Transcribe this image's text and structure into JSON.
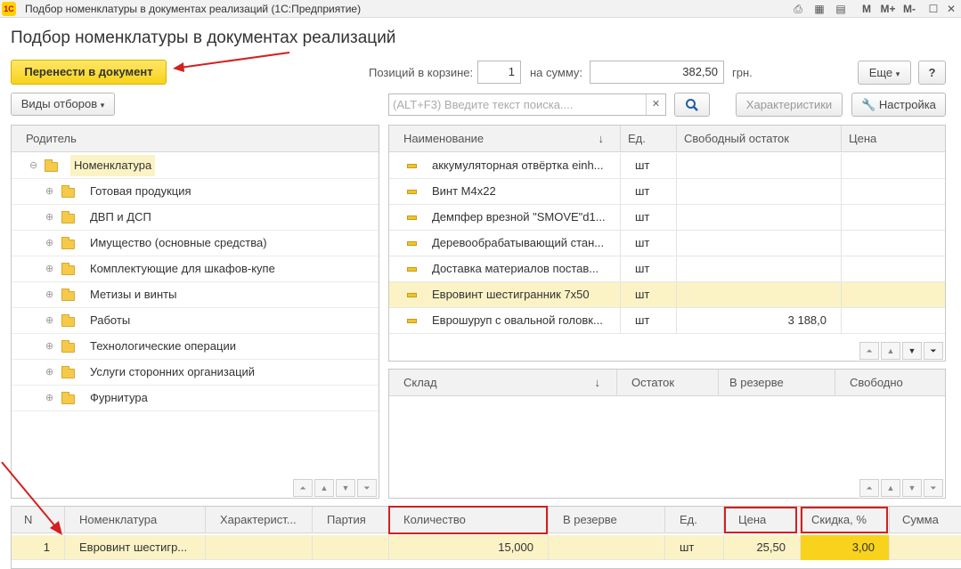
{
  "window": {
    "title": "Подбор номенклатуры в документах реализаций  (1С:Предприятие)",
    "logo": "1С",
    "controls": {
      "m": "M",
      "m_plus": "M+",
      "m_minus": "M-"
    }
  },
  "form": {
    "title": "Подбор номенклатуры в документах реализаций",
    "transfer_button": "Перенести в документ",
    "positions_label": "Позиций в корзине:",
    "positions_value": "1",
    "sum_label": "на сумму:",
    "sum_value": "382,50",
    "currency": "грн.",
    "more_button": "Еще",
    "help_button": "?",
    "filter_types_button": "Виды отборов",
    "search_placeholder": "(ALT+F3) Введите текст поиска....",
    "characteristics_button": "Характеристики",
    "settings_button": "Настройка"
  },
  "tree": {
    "header": "Родитель",
    "root": "Номенклатура",
    "items": [
      "Готовая продукция",
      "ДВП и ДСП",
      "Имущество (основные средства)",
      "Комплектующие для шкафов-купе",
      "Метизы и винты",
      "Работы",
      "Технологические операции",
      "Услуги сторонних организаций",
      "Фурнитура"
    ]
  },
  "products": {
    "columns": [
      "Наименование",
      "Ед.",
      "Свободный остаток",
      "Цена"
    ],
    "rows": [
      {
        "name": "аккумуляторная отвёртка einh...",
        "unit": "шт",
        "free": "",
        "price": ""
      },
      {
        "name": "Винт М4х22",
        "unit": "шт",
        "free": "",
        "price": ""
      },
      {
        "name": "Демпфер врезной \"SMOVE\"d1...",
        "unit": "шт",
        "free": "",
        "price": ""
      },
      {
        "name": "Деревообрабатывающий стан...",
        "unit": "шт",
        "free": "",
        "price": ""
      },
      {
        "name": "Доставка материалов постав...",
        "unit": "шт",
        "free": "",
        "price": ""
      },
      {
        "name": "Евровинт шестигранник 7х50",
        "unit": "шт",
        "free": "",
        "price": ""
      },
      {
        "name": "Еврошуруп с овальной головк...",
        "unit": "шт",
        "free": "3 188,0",
        "price": ""
      }
    ]
  },
  "warehouse": {
    "columns": [
      "Склад",
      "Остаток",
      "В резерве",
      "Свободно"
    ]
  },
  "cart": {
    "columns": [
      "N",
      "Номенклатура",
      "Характерист...",
      "Партия",
      "Количество",
      "В резерве",
      "Ед.",
      "Цена",
      "Скидка, %",
      "Сумма"
    ],
    "rows": [
      {
        "n": "1",
        "name": "Евровинт шестигр...",
        "char": "",
        "batch": "",
        "qty": "15,000",
        "reserve": "",
        "unit": "шт",
        "price": "25,50",
        "discount": "3,00",
        "sum": ""
      }
    ]
  },
  "colors": {
    "accent_yellow": "#f7d31a",
    "selection": "#fbf3c5",
    "annotation_red": "#d32020"
  }
}
